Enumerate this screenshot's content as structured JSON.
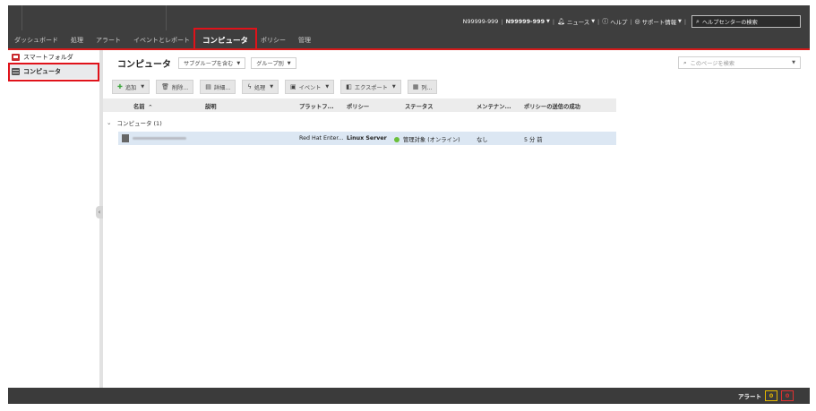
{
  "header": {
    "user_1": "N99999-999",
    "user_2": "N99999-999",
    "news": "ニュース",
    "help": "ヘルプ",
    "support": "サポート情報",
    "help_center_search_placeholder": "ヘルプセンターの検索",
    "nav_tabs": [
      "ダッシュボード",
      "処理",
      "アラート",
      "イベントとレポート",
      "コンピュータ",
      "ポリシー",
      "管理"
    ],
    "active_tab": "コンピュータ"
  },
  "sidebar": {
    "items": [
      {
        "label": "スマートフォルダ",
        "icon": "smart-folder-icon"
      },
      {
        "label": "コンピュータ",
        "icon": "computer-icon",
        "active": true
      }
    ]
  },
  "main": {
    "title": "コンピュータ",
    "subgroup_dropdown": "サブグループを含む",
    "group_dropdown": "グループ別",
    "page_search_placeholder": "このページを検索",
    "toolbar": {
      "add": "追加",
      "delete": "削除...",
      "details": "詳細...",
      "actions": "処理",
      "events": "イベント",
      "export": "エクスポート",
      "columns": "列..."
    },
    "columns": [
      "名前",
      "説明",
      "プラットフ...",
      "ポリシー",
      "ステータス",
      "メンテナン...",
      "ポリシーの送信の成功"
    ],
    "sort_indicator": "^",
    "group_label": "コンピュータ (1)",
    "rows": [
      {
        "name": "",
        "description": "",
        "platform": "Red Hat Enter...",
        "policy": "Linux Server",
        "status": "管理対象 (オンライン)",
        "maintenance": "なし",
        "policy_sent": "5 分 前"
      }
    ]
  },
  "footer": {
    "alerts_label": "アラート",
    "warning_count": "0",
    "critical_count": "0"
  },
  "colors": {
    "accent_red": "#e0121a",
    "header_bg": "#3e3e3e",
    "row_selected": "#dce7f3",
    "status_online": "#6abf3a"
  }
}
